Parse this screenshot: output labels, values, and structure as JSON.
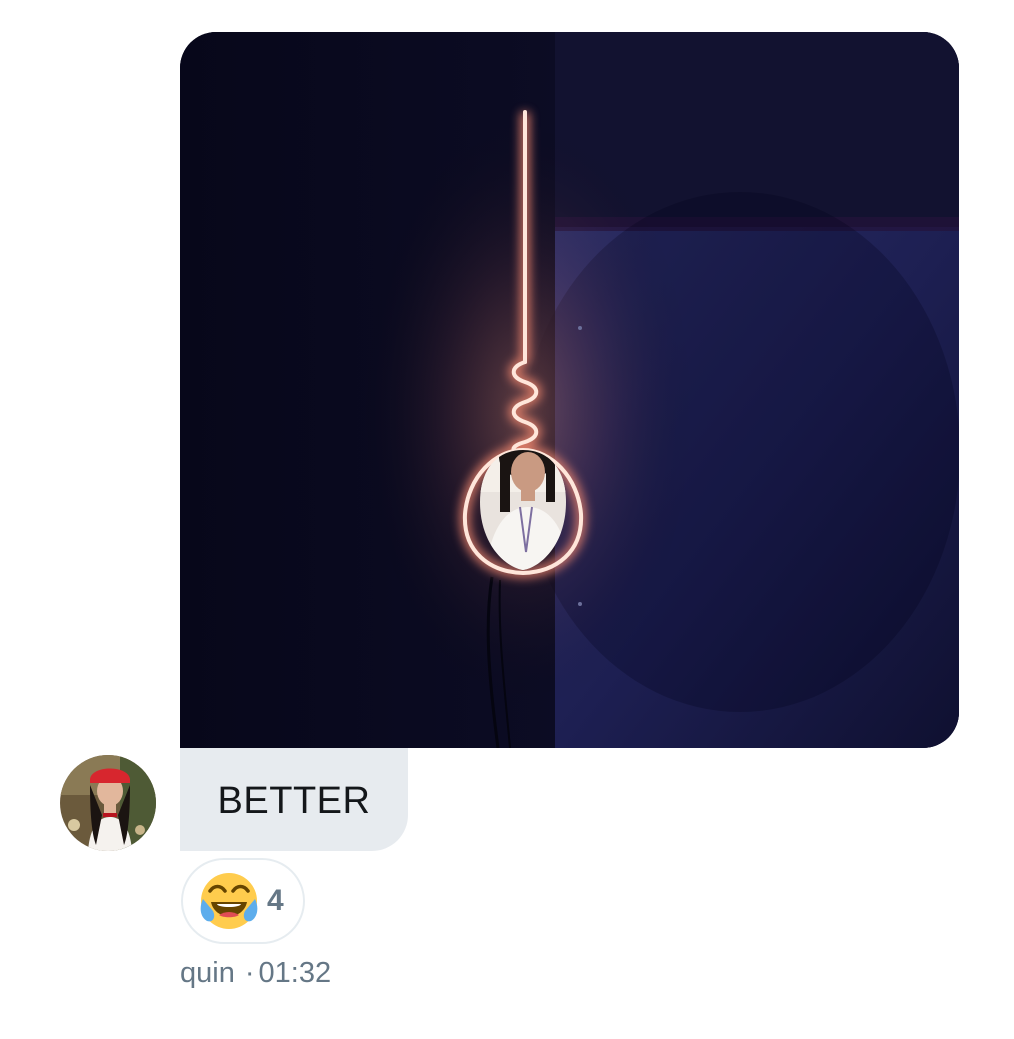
{
  "message": {
    "attachment": {
      "type": "image",
      "subject": "neon-lightbulb-photo"
    },
    "text": "BETTER",
    "reactions": [
      {
        "emoji": "face-with-tears-of-joy",
        "count": "4"
      }
    ],
    "sender": "quin",
    "separator": "·",
    "time": "01:32"
  },
  "colors": {
    "bubble_bg": "#e7ebef",
    "meta_text": "#657786",
    "reaction_border": "#e6ecf0",
    "neon": "#ffd9c9"
  }
}
